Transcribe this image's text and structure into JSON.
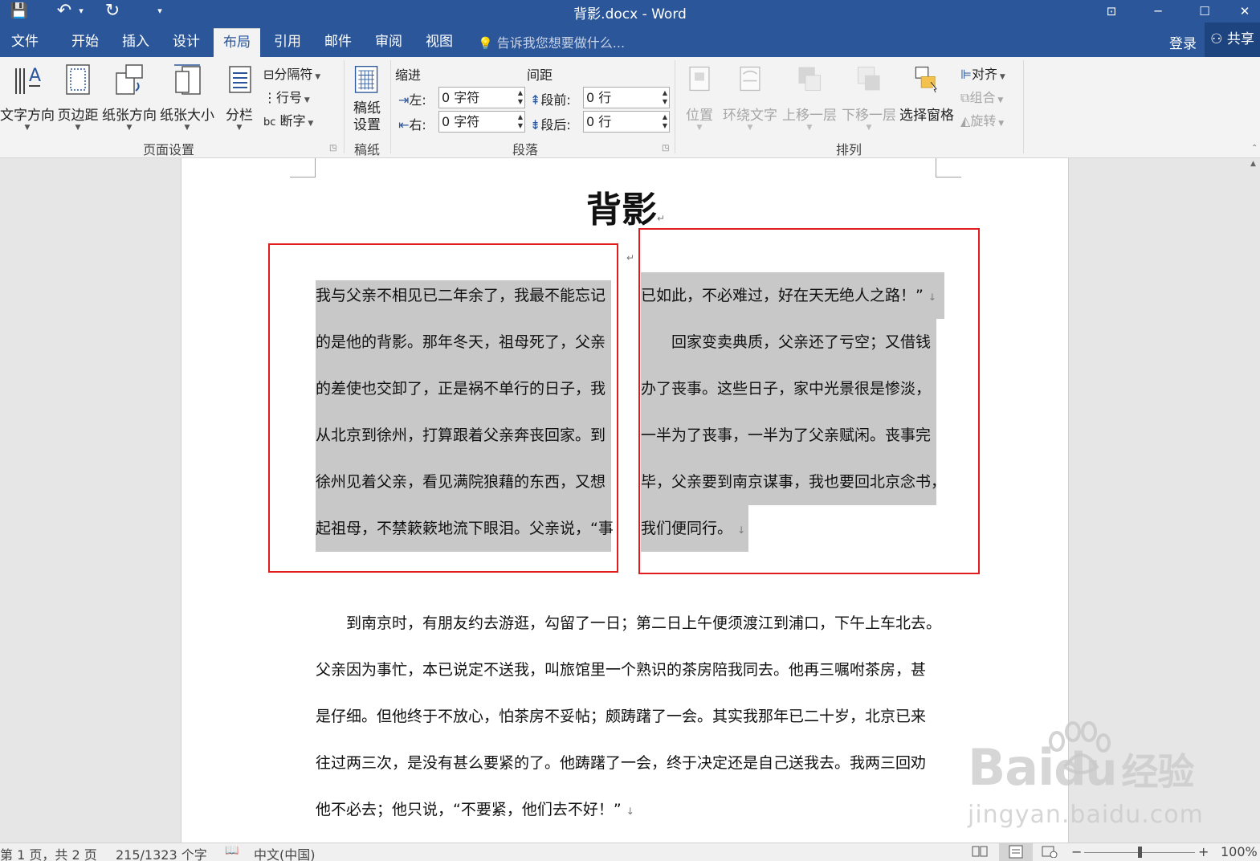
{
  "titlebar": {
    "title": "背影.docx - Word",
    "qat": {
      "save_icon": "💾",
      "undo_icon": "↶",
      "undo_caret": "▾",
      "redo_icon": "↻",
      "customize_icon": "▾"
    },
    "window": {
      "ribbon_display_icon": "⊡",
      "minimize_icon": "─",
      "maximize_icon": "☐",
      "close_icon": "✕"
    }
  },
  "tabs": [
    "文件",
    "开始",
    "插入",
    "设计",
    "布局",
    "引用",
    "邮件",
    "审阅",
    "视图"
  ],
  "tell_me": "告诉我您想要做什么...",
  "signin": "登录",
  "share": "共享",
  "ribbon": {
    "page_setup": {
      "label": "页面设置",
      "text_direction": "文字方向",
      "margins": "页边距",
      "orientation": "纸张方向",
      "size": "纸张大小",
      "columns": "分栏",
      "breaks": "分隔符",
      "line_numbers": "行号",
      "hyphenation": "断字"
    },
    "manuscript": {
      "label": "稿纸",
      "settings_line1": "稿纸",
      "settings_line2": "设置"
    },
    "paragraph": {
      "label": "段落",
      "indent_header": "缩进",
      "spacing_header": "间距",
      "left_label": "左:",
      "right_label": "右:",
      "before_label": "段前:",
      "after_label": "段后:",
      "left_value": "0 字符",
      "right_value": "0 字符",
      "before_value": "0 行",
      "after_value": "0 行"
    },
    "arrange": {
      "label": "排列",
      "position": "位置",
      "wrap_text": "环绕文字",
      "bring_forward": "上移一层",
      "send_backward": "下移一层",
      "selection_pane": "选择窗格",
      "align": "对齐",
      "group": "组合",
      "rotate": "旋转"
    }
  },
  "document": {
    "title": "背影",
    "col1": [
      "我与父亲不相见已二年余了，我最不能忘记",
      "的是他的背影。那年冬天，祖母死了，父亲",
      "的差使也交卸了，正是祸不单行的日子，我",
      "从北京到徐州，打算跟着父亲奔丧回家。到",
      "徐州见着父亲，看见满院狼藉的东西，又想",
      "起祖母，不禁簌簌地流下眼泪。父亲说，“事"
    ],
    "col2": [
      "已如此，不必难过，好在天无绝人之路！”",
      "　　回家变卖典质，父亲还了亏空；又借钱",
      "办了丧事。这些日子，家中光景很是惨淡，",
      "一半为了丧事，一半为了父亲赋闲。丧事完",
      "毕，父亲要到南京谋事，我也要回北京念书，",
      "我们便同行。"
    ],
    "body": [
      "　　到南京时，有朋友约去游逛，勾留了一日；第二日上午便须渡江到浦口，下午上车北去。",
      "父亲因为事忙，本已说定不送我，叫旅馆里一个熟识的茶房陪我同去。他再三嘱咐茶房，甚",
      "是仔细。但他终于不放心，怕茶房不妥帖；颇踌躇了一会。其实我那年已二十岁，北京已来",
      "往过两三次，是没有甚么要紧的了。他踌躇了一会，终于决定还是自己送我去。我两三回劝",
      "他不必去；他只说，“不要紧，他们去不好！”"
    ],
    "para_mark": "↵",
    "line_mark": "↓"
  },
  "status": {
    "page": "第 1 页，共 2 页",
    "words": "215/1323 个字",
    "proof_icon": "📖",
    "language": "中文(中国)",
    "zoom_minus": "−",
    "zoom_plus": "+",
    "zoom": "100%",
    "zoom_level_fraction": 0.5
  },
  "watermark": {
    "brand": "Bai",
    "brand2": "du",
    "brand_cn": "经验",
    "url": "jingyan.baidu.com"
  }
}
